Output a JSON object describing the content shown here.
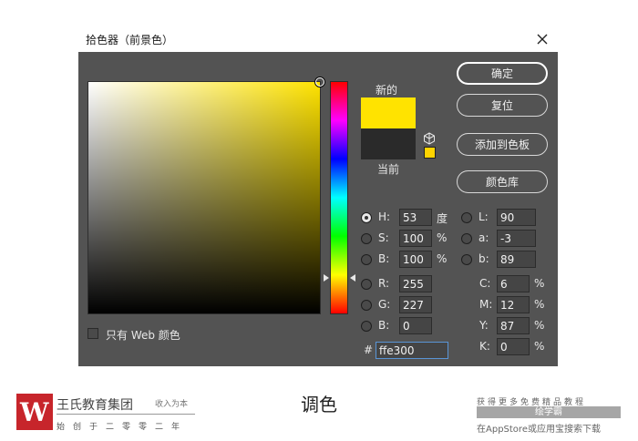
{
  "dialog": {
    "title": "拾色器（前景色）"
  },
  "swatches": {
    "new_label": "新的",
    "current_label": "当前",
    "new_color": "#ffe300",
    "current_color": "#2a2a2a"
  },
  "buttons": {
    "ok": "确定",
    "reset": "复位",
    "add_to_swatches": "添加到色板",
    "color_libraries": "颜色库"
  },
  "hsb": {
    "h_label": "H:",
    "h_value": "53",
    "h_unit": "度",
    "s_label": "S:",
    "s_value": "100",
    "s_unit": "%",
    "b_label": "B:",
    "b_value": "100",
    "b_unit": "%"
  },
  "rgb": {
    "r_label": "R:",
    "r_value": "255",
    "g_label": "G:",
    "g_value": "227",
    "b_label": "B:",
    "b_value": "0"
  },
  "lab": {
    "l_label": "L:",
    "l_value": "90",
    "a_label": "a:",
    "a_value": "-3",
    "b_label": "b:",
    "b_value": "89"
  },
  "cmyk": {
    "c_label": "C:",
    "c_value": "6",
    "c_unit": "%",
    "m_label": "M:",
    "m_value": "12",
    "m_unit": "%",
    "y_label": "Y:",
    "y_value": "87",
    "y_unit": "%",
    "k_label": "K:",
    "k_value": "0",
    "k_unit": "%"
  },
  "hex": {
    "label": "#",
    "value": "ffe300"
  },
  "web_only": {
    "label": "只有 Web 颜色",
    "checked": false
  },
  "selected_mode": "H",
  "footer": {
    "brand_name": "王氏教育集团",
    "brand_tag": "收入为本",
    "brand_sub": "始创于二零零二年",
    "caption": "调色",
    "promo_top": "获得更多免费精品教程",
    "promo_mid": "绘学霸",
    "promo_bot": "在AppStore或应用宝搜索下载"
  }
}
